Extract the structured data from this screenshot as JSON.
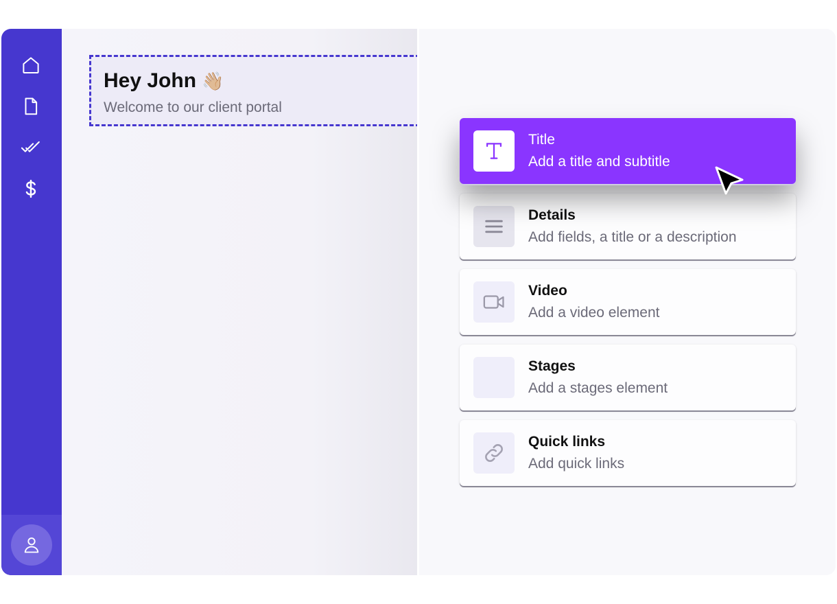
{
  "colors": {
    "sidebar": "#4637cf",
    "accent": "#8a35ff",
    "dashed_border": "#4637cf"
  },
  "sidebar": {
    "items": [
      {
        "icon": "home-icon"
      },
      {
        "icon": "document-icon"
      },
      {
        "icon": "double-check-icon"
      },
      {
        "icon": "dollar-icon"
      }
    ],
    "avatar_icon": "user-icon"
  },
  "welcome": {
    "title": "Hey John",
    "emoji": "👋🏼",
    "subtitle": "Welcome to our client portal"
  },
  "elements": [
    {
      "title": "Title",
      "subtitle": "Add a title and subtitle",
      "icon": "text-t-icon",
      "active": true
    },
    {
      "title": "Details",
      "subtitle": "Add fields, a title or a description",
      "icon": "lines-icon",
      "active": false
    },
    {
      "title": "Video",
      "subtitle": "Add a video element",
      "icon": "video-camera-icon",
      "active": false
    },
    {
      "title": "Stages",
      "subtitle": "Add a stages element",
      "icon": "stages-icon",
      "active": false
    },
    {
      "title": "Quick links",
      "subtitle": "Add quick links",
      "icon": "link-icon",
      "active": false
    }
  ]
}
